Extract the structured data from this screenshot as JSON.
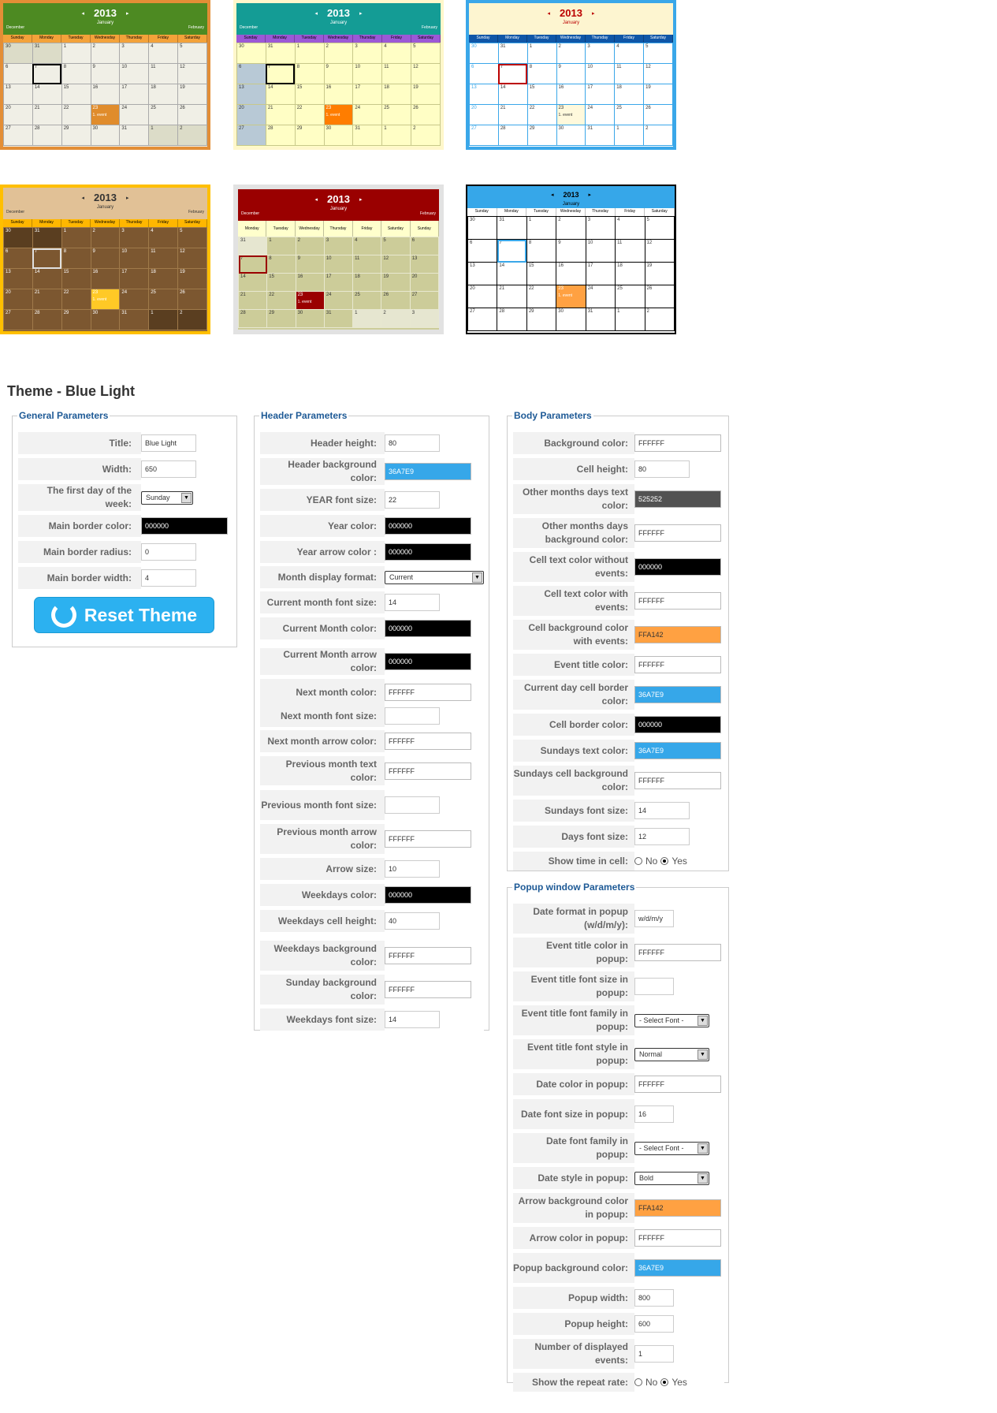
{
  "theme_thumbnails": [
    {
      "name": "green",
      "frame": "#e38e36",
      "header": "#4d8a22",
      "bar": "#f3a23a",
      "bg": "#f0efe6",
      "year_color": "#ffffff",
      "ev_color": "#e08c2c"
    },
    {
      "name": "teal",
      "frame": "#fff7cb",
      "header": "#149c95",
      "bar": "#9c58d6",
      "bg": "#fffec5",
      "year_color": "#ffffff",
      "ev_color": "#ff7d00"
    },
    {
      "name": "blue-white",
      "frame": "#3aa7e9",
      "header": "#fdf5d0",
      "bar": "#0f56a7",
      "bg": "#ffffff",
      "year_color": "#bb0000",
      "ev_color": "#fff9dc"
    },
    {
      "name": "brown",
      "frame": "#ffbf00",
      "header": "#e1c196",
      "bar": "#ffb700",
      "bg": "#7c5730",
      "year_color": "#333333",
      "ev_color": "#ffc926"
    },
    {
      "name": "red",
      "frame": "#e2e2e2",
      "header": "#9a0000",
      "bar": "#ffffcc",
      "bg": "#cccc99",
      "year_color": "#ffffff",
      "ev_color": "#9a0000"
    },
    {
      "name": "blue-light",
      "frame": "#000000",
      "header": "#36a7e9",
      "bar": "#ffffff",
      "bg": "#ffffff",
      "year_color": "#000000",
      "ev_color": "#ffa142"
    }
  ],
  "calendar": {
    "year": "2013",
    "month": "January",
    "prev_month": "December",
    "next_month": "February",
    "weekdays_sun": [
      "Sunday",
      "Monday",
      "Tuesday",
      "Wednesday",
      "Thursday",
      "Friday",
      "Saturday"
    ],
    "weekdays_mon": [
      "Monday",
      "Tuesday",
      "Wednesday",
      "Thursday",
      "Friday",
      "Saturday",
      "Sunday"
    ],
    "event_text": "1. event"
  },
  "page_title": "Theme - Blue Light",
  "reset_button": "Reset Theme",
  "general": {
    "legend": "General Parameters",
    "rows": [
      {
        "label": "Title:",
        "value": "Blue Light",
        "type": "text"
      },
      {
        "label": "Width:",
        "value": "650",
        "type": "text"
      },
      {
        "label": "The first day of the week:",
        "value": "Sunday",
        "type": "select"
      },
      {
        "label": "Main border color:",
        "value": "000000",
        "type": "color",
        "color": "#000000"
      },
      {
        "label": "Main border radius:",
        "value": "0",
        "type": "text"
      },
      {
        "label": "Main border width:",
        "value": "4",
        "type": "text"
      }
    ]
  },
  "header": {
    "legend": "Header Parameters",
    "rows": [
      {
        "label": "Header height:",
        "value": "80",
        "type": "text"
      },
      {
        "label": "Header background color:",
        "value": "36A7E9",
        "type": "color",
        "color": "#36A7E9"
      },
      {
        "label": "YEAR font size:",
        "value": "22",
        "type": "text"
      },
      {
        "label": "Year color:",
        "value": "000000",
        "type": "color",
        "color": "#000000"
      },
      {
        "label": "Year arrow color :",
        "value": "000000",
        "type": "color",
        "color": "#000000"
      },
      {
        "label": "Month display format:",
        "value": "Current",
        "type": "select"
      },
      {
        "label": "Current month font size:",
        "value": "14",
        "type": "text"
      },
      {
        "label": "Current Month color:",
        "value": "000000",
        "type": "color",
        "color": "#000000"
      },
      {
        "label": "Current Month arrow color:",
        "value": "000000",
        "type": "color",
        "color": "#000000"
      },
      {
        "label": "Next month color:",
        "value": "FFFFFF",
        "type": "color",
        "color": "#FFFFFF"
      },
      {
        "label": "Next month font size:",
        "value": "",
        "type": "text"
      },
      {
        "label": "Next month arrow color:",
        "value": "FFFFFF",
        "type": "color",
        "color": "#FFFFFF"
      },
      {
        "label": "Previous month text color:",
        "value": "FFFFFF",
        "type": "color",
        "color": "#FFFFFF"
      },
      {
        "label": "Previous month font size:",
        "value": "",
        "type": "text"
      },
      {
        "label": "Previous month arrow color:",
        "value": "FFFFFF",
        "type": "color",
        "color": "#FFFFFF"
      },
      {
        "label": "Arrow size:",
        "value": "10",
        "type": "text"
      },
      {
        "label": "Weekdays color:",
        "value": "000000",
        "type": "color",
        "color": "#000000"
      },
      {
        "label": "Weekdays cell height:",
        "value": "40",
        "type": "text"
      },
      {
        "label": "Weekdays background color:",
        "value": "FFFFFF",
        "type": "color",
        "color": "#FFFFFF"
      },
      {
        "label": "Sunday background color:",
        "value": "FFFFFF",
        "type": "color",
        "color": "#FFFFFF"
      },
      {
        "label": "Weekdays font size:",
        "value": "14",
        "type": "text"
      }
    ]
  },
  "body": {
    "legend": "Body Parameters",
    "rows": [
      {
        "label": "Background color:",
        "value": "FFFFFF",
        "type": "color",
        "color": "#FFFFFF"
      },
      {
        "label": "Cell height:",
        "value": "80",
        "type": "text"
      },
      {
        "label": "Other months days text color:",
        "value": "525252",
        "type": "color",
        "color": "#525252"
      },
      {
        "label": "Other months days background color:",
        "value": "FFFFFF",
        "type": "color",
        "color": "#FFFFFF"
      },
      {
        "label": "Cell text color without events:",
        "value": "000000",
        "type": "color",
        "color": "#000000"
      },
      {
        "label": "Cell text color with events:",
        "value": "FFFFFF",
        "type": "color",
        "color": "#FFFFFF"
      },
      {
        "label": "Cell background color with events:",
        "value": "FFA142",
        "type": "color",
        "color": "#FFA142"
      },
      {
        "label": "Event title color:",
        "value": "FFFFFF",
        "type": "color",
        "color": "#FFFFFF"
      },
      {
        "label": "Current day cell border color:",
        "value": "36A7E9",
        "type": "color",
        "color": "#36A7E9"
      },
      {
        "label": "Cell border color:",
        "value": "000000",
        "type": "color",
        "color": "#000000"
      },
      {
        "label": "Sundays text color:",
        "value": "36A7E9",
        "type": "color",
        "color": "#36A7E9"
      },
      {
        "label": "Sundays cell background color:",
        "value": "FFFFFF",
        "type": "color",
        "color": "#FFFFFF"
      },
      {
        "label": "Sundays font size:",
        "value": "14",
        "type": "text"
      },
      {
        "label": "Days font size:",
        "value": "12",
        "type": "text"
      },
      {
        "label": "Show time in cell:",
        "type": "radio",
        "options": [
          "No",
          "Yes"
        ],
        "selected": "Yes"
      }
    ]
  },
  "popup": {
    "legend": "Popup window Parameters",
    "rows": [
      {
        "label": "Date format in popup (w/d/m/y):",
        "value": "w/d/m/y",
        "type": "text"
      },
      {
        "label": "Event title color in popup:",
        "value": "FFFFFF",
        "type": "color",
        "color": "#FFFFFF"
      },
      {
        "label": "Event title font size in popup:",
        "value": "",
        "type": "text"
      },
      {
        "label": "Event title font family in popup:",
        "value": "- Select Font -",
        "type": "select"
      },
      {
        "label": "Event title font style in popup:",
        "value": "Normal",
        "type": "select"
      },
      {
        "label": "Date color in popup:",
        "value": "FFFFFF",
        "type": "color",
        "color": "#FFFFFF"
      },
      {
        "label": "Date font size in popup:",
        "value": "16",
        "type": "text"
      },
      {
        "label": "Date font family in popup:",
        "value": "- Select Font -",
        "type": "select"
      },
      {
        "label": "Date style in popup:",
        "value": "Bold",
        "type": "select"
      },
      {
        "label": "Arrow background color in popup:",
        "value": "FFA142",
        "type": "color",
        "color": "#FFA142"
      },
      {
        "label": "Arrow color in popup:",
        "value": "FFFFFF",
        "type": "color",
        "color": "#FFFFFF"
      },
      {
        "label": "Popup background color:",
        "value": "36A7E9",
        "type": "color",
        "color": "#36A7E9"
      },
      {
        "label": "Popup width:",
        "value": "800",
        "type": "text"
      },
      {
        "label": "Popup height:",
        "value": "600",
        "type": "text"
      },
      {
        "label": "Number of displayed events:",
        "value": "1",
        "type": "text"
      },
      {
        "label": "Show the repeat rate:",
        "type": "radio",
        "options": [
          "No",
          "Yes"
        ],
        "selected": "Yes"
      }
    ]
  }
}
